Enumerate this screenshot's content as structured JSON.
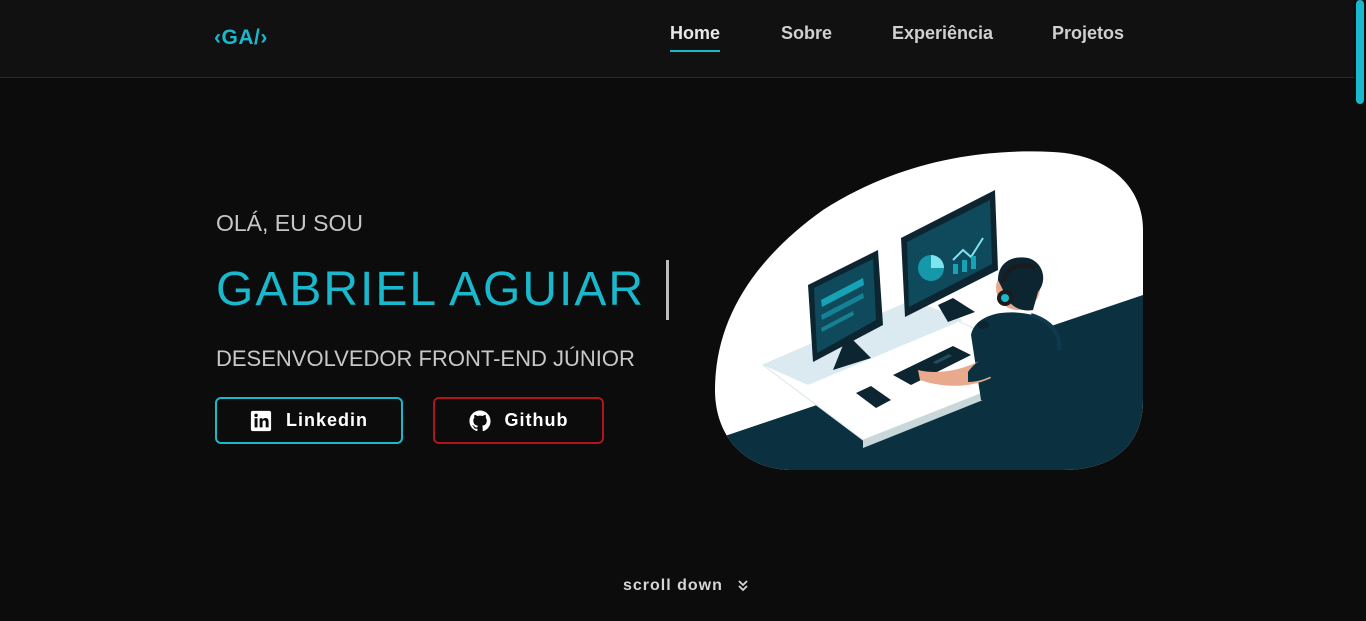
{
  "header": {
    "logo": "‹GA/›",
    "nav": [
      {
        "label": "Home",
        "active": true
      },
      {
        "label": "Sobre",
        "active": false
      },
      {
        "label": "Experiência",
        "active": false
      },
      {
        "label": "Projetos",
        "active": false
      }
    ]
  },
  "hero": {
    "greeting": "OLÁ, EU SOU",
    "name": "GABRIEL AGUIAR",
    "role": "DESENVOLVEDOR FRONT-END JÚNIOR",
    "buttons": {
      "linkedin_label": "Linkedin",
      "github_label": "Github"
    }
  },
  "scroll": {
    "label": "scroll down"
  },
  "colors": {
    "accent": "#1ab8cc",
    "github_border": "#b3141b",
    "background": "#0c0c0c",
    "illustration_dark": "#0b3140"
  },
  "icons": [
    "linkedin-icon",
    "github-icon",
    "double-chevron-down-icon"
  ]
}
